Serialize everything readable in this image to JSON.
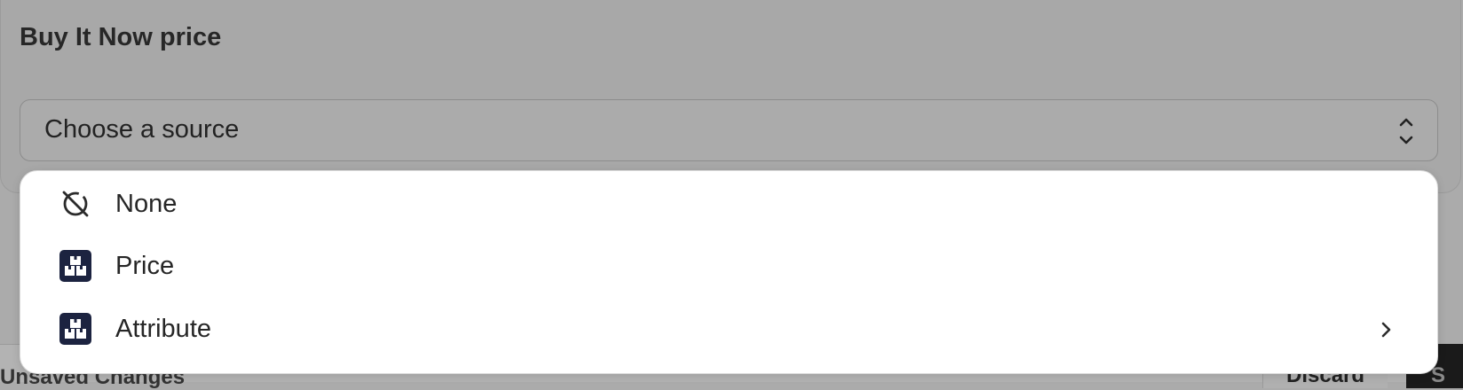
{
  "section": {
    "title": "Buy It Now price"
  },
  "select": {
    "placeholder": "Choose a source",
    "icon": "chevron-up-down-icon"
  },
  "dropdown": {
    "options": [
      {
        "label": "None",
        "icon": "none-circle-slash-icon",
        "has_submenu": false
      },
      {
        "label": "Price",
        "icon": "product-boxes-icon",
        "has_submenu": false
      },
      {
        "label": "Attribute",
        "icon": "product-boxes-icon",
        "has_submenu": true
      }
    ]
  },
  "footer": {
    "left_text": "Unsaved Changes",
    "discard_label": "Discard",
    "save_label": "S"
  },
  "colors": {
    "overlay": "#ababab",
    "dropdown_bg": "#ffffff",
    "icon_badge": "#1c2340",
    "text": "#262626"
  }
}
